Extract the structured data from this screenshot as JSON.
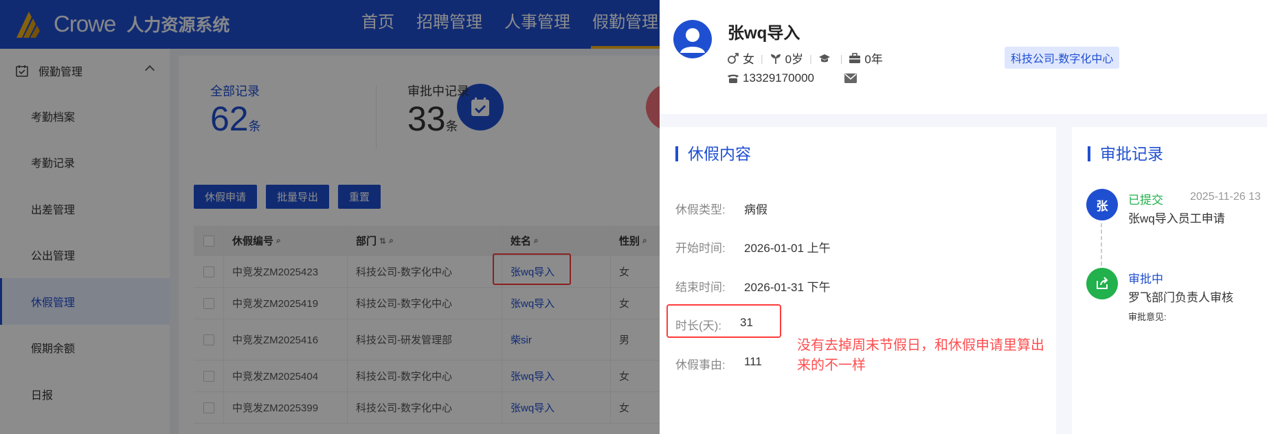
{
  "app": {
    "logo_text": "Crowe",
    "system_name": "人力资源系统",
    "nav": [
      "首页",
      "招聘管理",
      "人事管理",
      "假勤管理"
    ],
    "active_nav": "假勤管理"
  },
  "sidebar": {
    "group": "假勤管理",
    "items": [
      "考勤档案",
      "考勤记录",
      "出差管理",
      "公出管理",
      "休假管理",
      "假期余额",
      "日报"
    ],
    "active": "休假管理"
  },
  "stats": {
    "total_label": "全部记录",
    "total_value": "62",
    "total_unit": "条",
    "pending_label": "审批中记录",
    "pending_value": "33",
    "pending_unit": "条"
  },
  "toolbar": {
    "apply_label": "休假申请",
    "export_label": "批量导出",
    "reset_label": "重置"
  },
  "table": {
    "headers": [
      "休假编号",
      "部门",
      "姓名",
      "性别"
    ],
    "rows": [
      {
        "id": "中竞发ZM2025423",
        "dept": "科技公司-数字化中心",
        "name": "张wq导入",
        "gender": "女"
      },
      {
        "id": "中竞发ZM2025419",
        "dept": "科技公司-数字化中心",
        "name": "张wq导入",
        "gender": "女"
      },
      {
        "id": "中竞发ZM2025416",
        "dept": "科技公司-研发管理部",
        "name": "柴sir",
        "gender": "男"
      },
      {
        "id": "中竞发ZM2025404",
        "dept": "科技公司-数字化中心",
        "name": "张wq导入",
        "gender": "女"
      },
      {
        "id": "中竞发ZM2025399",
        "dept": "科技公司-数字化中心",
        "name": "张wq导入",
        "gender": "女"
      }
    ]
  },
  "drawer": {
    "name": "张wq导入",
    "gender": "女",
    "age": "0岁",
    "tenure": "0年",
    "dept": "科技公司-数字化中心",
    "phone": "13329170000",
    "leave_title": "休假内容",
    "fields": {
      "type_label": "休假类型:",
      "type_value": "病假",
      "start_label": "开始时间:",
      "start_value": "2026-01-01 上午",
      "end_label": "结束时间:",
      "end_value": "2026-01-31 下午",
      "duration_label": "时长(天):",
      "duration_value": "31",
      "reason_label": "休假事由:",
      "reason_value": "111"
    },
    "annotation": "没有去掉周末节假日，和休假申请里算出来的不一样",
    "approval_title": "审批记录",
    "timeline": [
      {
        "avatar": "张",
        "status": "已提交",
        "time": "2025-11-26 13",
        "text": "张wq导入员工申请"
      },
      {
        "status": "审批中",
        "text": "罗飞部门负责人审核",
        "note": "审批意见:"
      }
    ]
  },
  "colors": {
    "brand": "#1f4fd1",
    "accent": "#f3b21a",
    "submitted": "#22b14c",
    "danger": "#ff3b3b"
  }
}
